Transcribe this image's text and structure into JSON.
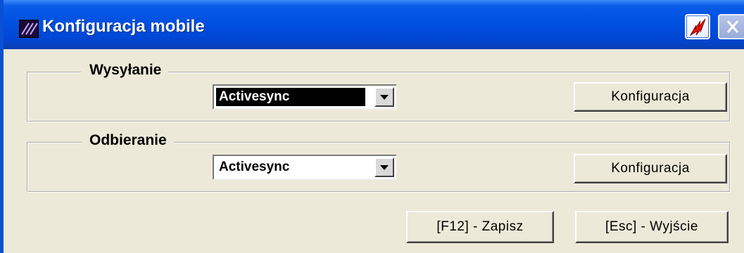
{
  "window": {
    "title": "Konfiguracja mobile",
    "app_icon": "app-logo-icon",
    "controls": {
      "app_button_icon": "lightning-icon",
      "close_button_icon": "close-icon"
    }
  },
  "groups": [
    {
      "legend": "Wysyłanie",
      "combo_value": "Activesync",
      "combo_selected": true,
      "button_label": "Konfiguracja"
    },
    {
      "legend": "Odbieranie",
      "combo_value": "Activesync",
      "combo_selected": false,
      "button_label": "Konfiguracja"
    }
  ],
  "footer": {
    "save_label": "[F12] - Zapisz",
    "exit_label": "[Esc] - Wyjście"
  },
  "colors": {
    "titlebar": "#0050e0",
    "window_bg": "#ece9d8",
    "selection": "#000000"
  }
}
